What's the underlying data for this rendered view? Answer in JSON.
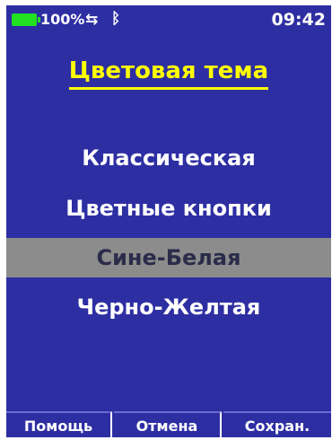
{
  "status": {
    "battery_percent": "100%",
    "battery_level": 1.0,
    "usb_icon": "usb-connected-icon",
    "bluetooth_icon": "bluetooth-icon",
    "time": "09:42"
  },
  "colors": {
    "background": "#2e2ea3",
    "title": "#ffff00",
    "battery": "#22e022",
    "selected_row": "#8c8c8c"
  },
  "title": "Цветовая тема",
  "options": [
    {
      "label": "Классическая",
      "selected": false
    },
    {
      "label": "Цветные кнопки",
      "selected": false
    },
    {
      "label": "Сине-Белая",
      "selected": true
    },
    {
      "label": "Черно-Желтая",
      "selected": false
    }
  ],
  "softkeys": {
    "help": "Помощь",
    "cancel": "Отмена",
    "save": "Сохран."
  }
}
